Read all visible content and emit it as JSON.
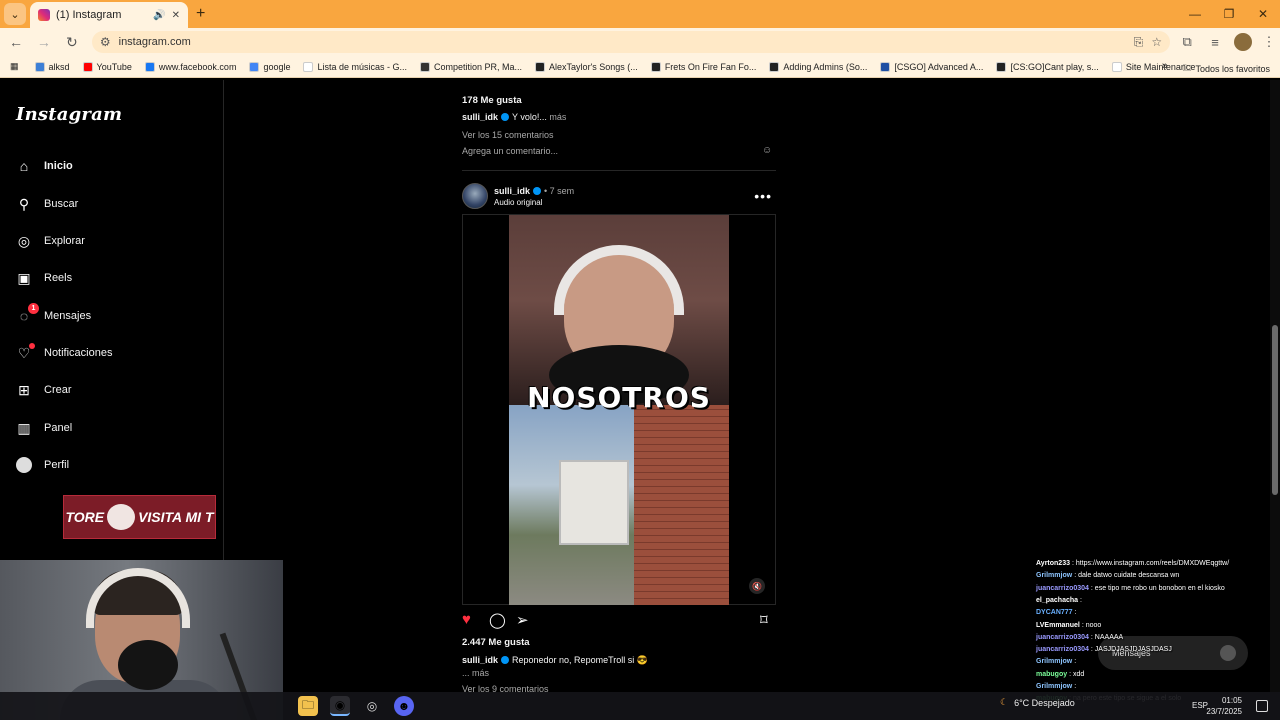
{
  "browser": {
    "tab_title": "(1) Instagram",
    "url": "instagram.com",
    "bookmarks": [
      {
        "label": "alksd",
        "color": "#3d7fd6"
      },
      {
        "label": "YouTube",
        "color": "#ff0000"
      },
      {
        "label": "www.facebook.com",
        "color": "#1877f2"
      },
      {
        "label": "google",
        "color": "#4285f4"
      },
      {
        "label": "Lista de músicas - G...",
        "color": "#ffffff"
      },
      {
        "label": "Competition PR, Ma...",
        "color": "#333333"
      },
      {
        "label": "AlexTaylor's Songs (...",
        "color": "#222222"
      },
      {
        "label": "Frets On Fire Fan Fo...",
        "color": "#222222"
      },
      {
        "label": "Adding Admins (So...",
        "color": "#222222"
      },
      {
        "label": "[CSGO] Advanced A...",
        "color": "#1f4fa3"
      },
      {
        "label": "[CS:GO]Cant play, s...",
        "color": "#222222"
      },
      {
        "label": "Site Maintenance",
        "color": "#ffffff"
      }
    ],
    "all_bookmarks": "Todos los favoritos"
  },
  "sidebar": {
    "logo": "Instagram",
    "items": [
      {
        "label": "Inicio",
        "icon": "home-icon"
      },
      {
        "label": "Buscar",
        "icon": "search-icon"
      },
      {
        "label": "Explorar",
        "icon": "compass-icon"
      },
      {
        "label": "Reels",
        "icon": "reels-icon"
      },
      {
        "label": "Mensajes",
        "icon": "messenger-icon",
        "badge": "1"
      },
      {
        "label": "Notificaciones",
        "icon": "heart-icon"
      },
      {
        "label": "Crear",
        "icon": "plus-square-icon"
      },
      {
        "label": "Panel",
        "icon": "dashboard-icon"
      },
      {
        "label": "Perfil",
        "icon": "avatar"
      }
    ],
    "banner_left": "TORE",
    "banner_right": "VISITA MI T"
  },
  "prev_post": {
    "likes": "178 Me gusta",
    "username": "sulli_idk",
    "caption": "Y volo!...",
    "more": "más",
    "comments": "Ver los 15 comentarios",
    "add_comment": "Agrega un comentario..."
  },
  "post": {
    "username": "sulli_idk",
    "time": "7 sem",
    "audio": "Audio original",
    "overlay_text": "NOSOTROS",
    "likes": "2.447 Me gusta",
    "caption": "Reponedor no, RepomeTroll si 😎",
    "more": "... más",
    "comments": "Ver los 9 comentarios"
  },
  "chat": [
    {
      "user": "Ayrton233",
      "text": ": https://www.instagram.com/reels/DMXDWEqgttw/",
      "color": "#ffffff"
    },
    {
      "user": "Grilmmjow",
      "text": ": dale datwo cuidate descansa wn",
      "color": "#8ec5ff"
    },
    {
      "user": "juancarrizo0304",
      "text": ": ese tipo me robo un bonobon en el kiosko",
      "color": "#9a9aff"
    },
    {
      "user": "el_pachacha",
      "text": ":",
      "color": "#ffffff"
    },
    {
      "user": "DYCAN777",
      "text": ":",
      "color": "#6ab0ff"
    },
    {
      "user": "LVEmmanuel",
      "text": ": nooo",
      "color": "#ffffff"
    },
    {
      "user": "juancarrizo0304",
      "text": ": NAAAAA",
      "color": "#9a9aff"
    },
    {
      "user": "juancarrizo0304",
      "text": ": JASJDJASJDJASJDASJ",
      "color": "#9a9aff"
    },
    {
      "user": "Grilmmjow",
      "text": ":",
      "color": "#8ec5ff"
    },
    {
      "user": "mabugoy",
      "text": ": xdd",
      "color": "#7cff9a"
    },
    {
      "user": "Grilmmjow",
      "text": ":",
      "color": "#8ec5ff"
    },
    {
      "user": "mabugoy",
      "text": ": na pero este tipo se sigue a el solo",
      "color": "#7cff9a"
    }
  ],
  "messages_pill": "Mensajes",
  "taskbar": {
    "weather": "6°C Despejado",
    "lang": "ESP",
    "time": "01:05",
    "date": "23/7/2025"
  }
}
